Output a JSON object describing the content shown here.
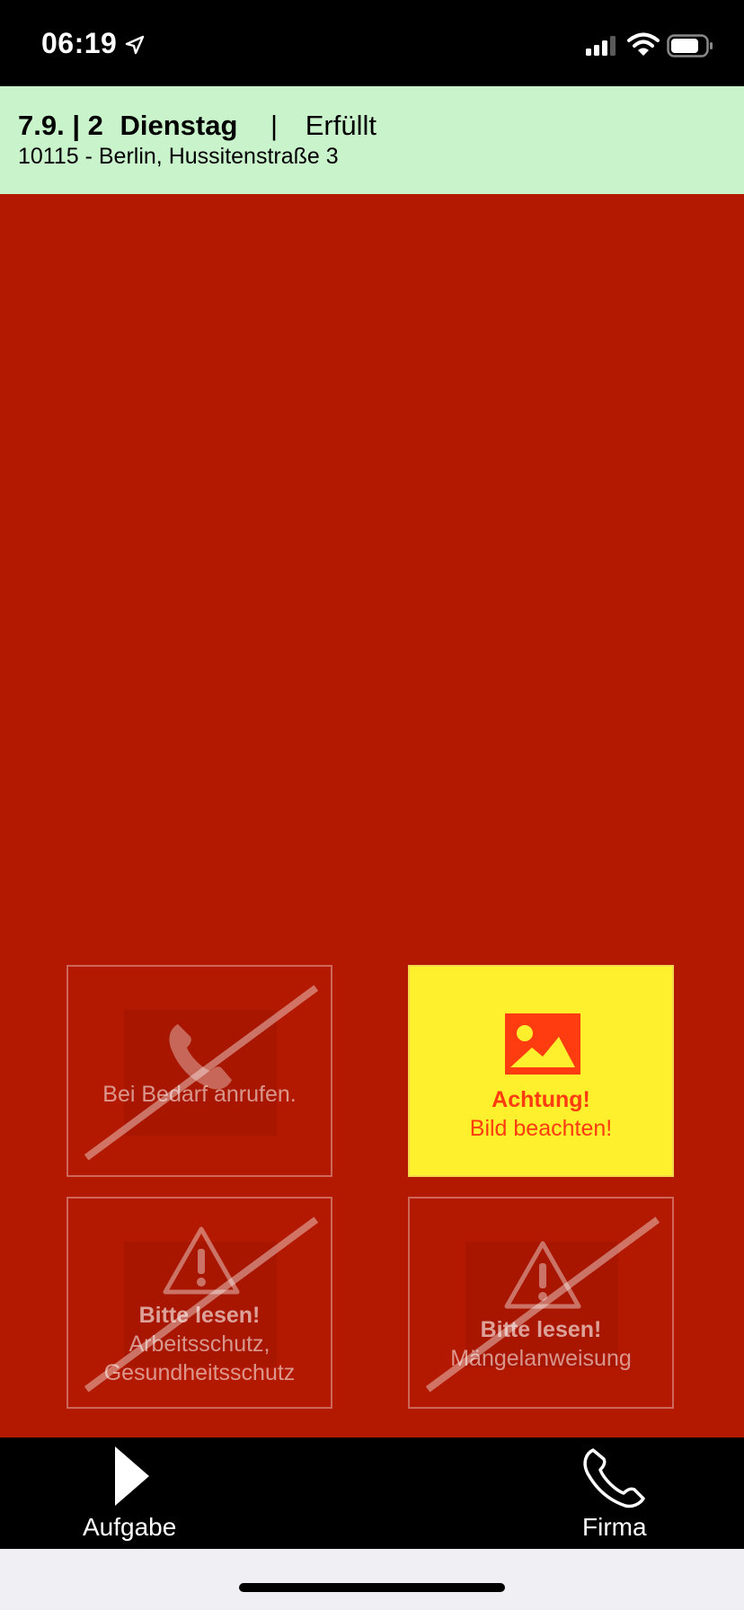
{
  "status_bar": {
    "time": "06:19"
  },
  "header": {
    "date_slot": "7.9. | 2",
    "weekday": "Dienstag",
    "separator": "|",
    "status": "Erfüllt",
    "address": "10115 - Berlin,  Hussitenstraße 3"
  },
  "tiles": {
    "call": {
      "label": "Bei Bedarf anrufen.",
      "icon": "phone-icon",
      "disabled": true
    },
    "image": {
      "title": "Achtung!",
      "subtitle": "Bild beachten!",
      "icon": "image-icon",
      "disabled": false
    },
    "safety": {
      "title": "Bitte lesen!",
      "line1": "Arbeitsschutz,",
      "line2": "Gesundheitsschutz",
      "icon": "warning-icon",
      "disabled": true
    },
    "defects": {
      "title": "Bitte lesen!",
      "line1": "Mängelanweisung",
      "icon": "warning-icon",
      "disabled": true
    }
  },
  "tab_bar": {
    "task": {
      "label": "Aufgabe",
      "icon": "play-icon"
    },
    "company": {
      "label": "Firma",
      "icon": "phone-icon"
    }
  },
  "colors": {
    "background": "#b31800",
    "header_bg": "#c9f3cb",
    "active_tile": "#fff02e",
    "active_text": "#ff3c10"
  }
}
